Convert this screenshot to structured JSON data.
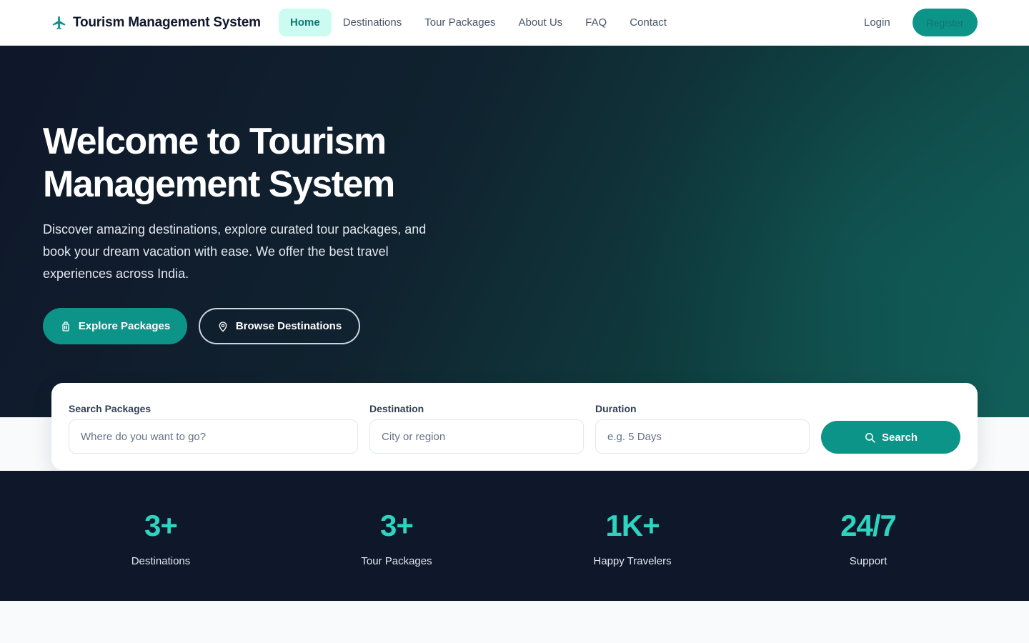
{
  "brand": {
    "name": "Tourism Management System",
    "icon": "airplane-icon"
  },
  "nav": {
    "links": [
      {
        "label": "Home",
        "active": true
      },
      {
        "label": "Destinations"
      },
      {
        "label": "Tour Packages"
      },
      {
        "label": "About Us"
      },
      {
        "label": "FAQ"
      },
      {
        "label": "Contact"
      }
    ],
    "login": "Login",
    "register": "Register"
  },
  "hero": {
    "title_line1": "Welcome to Tourism",
    "title_line2": "Management System",
    "subtitle": "Discover amazing destinations, explore curated tour packages, and book your dream vacation with ease. We offer the best travel experiences across India.",
    "primary_button": "Explore Packages",
    "secondary_button": "Browse Destinations"
  },
  "search": {
    "packages": {
      "label": "Search Packages",
      "placeholder": "Where do you want to go?"
    },
    "destination": {
      "label": "Destination",
      "placeholder": "City or region"
    },
    "duration": {
      "label": "Duration",
      "placeholder": "e.g. 5 Days"
    },
    "button": "Search"
  },
  "stats": [
    {
      "value": "3+",
      "label": "Destinations"
    },
    {
      "value": "3+",
      "label": "Tour Packages"
    },
    {
      "value": "1K+",
      "label": "Happy Travelers"
    },
    {
      "value": "24/7",
      "label": "Support"
    }
  ],
  "colors": {
    "accent": "#0d9488",
    "accent_light": "#2dd4bf",
    "dark": "#0f172a",
    "active_bg": "#ccfbf1"
  }
}
